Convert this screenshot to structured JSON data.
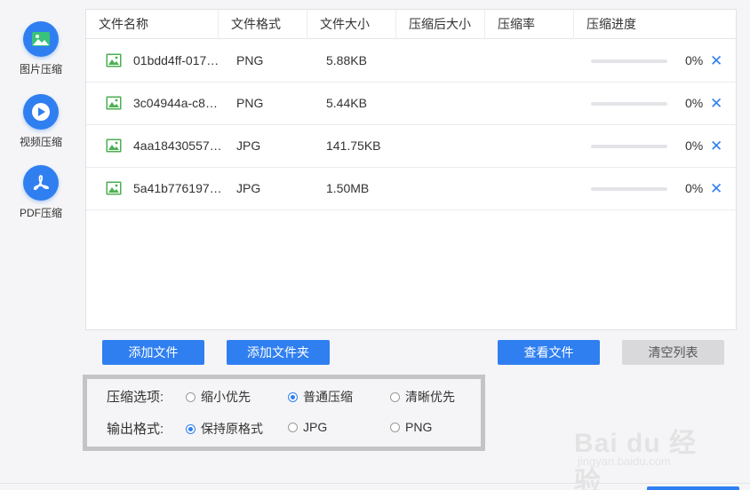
{
  "sidebar": {
    "items": [
      {
        "label": "图片压缩",
        "icon": "image-icon"
      },
      {
        "label": "视频压缩",
        "icon": "play-icon"
      },
      {
        "label": "PDF压缩",
        "icon": "pdf-icon"
      }
    ]
  },
  "table": {
    "headers": [
      "文件名称",
      "文件格式",
      "文件大小",
      "压缩后大小",
      "压缩率",
      "压缩进度"
    ],
    "rows": [
      {
        "name": "01bdd4ff-017…",
        "format": "PNG",
        "size": "5.88KB",
        "compressed_size": "",
        "ratio": "",
        "progress": 0,
        "progress_text": "0%",
        "remove": "✕"
      },
      {
        "name": "3c04944a-c8…",
        "format": "PNG",
        "size": "5.44KB",
        "compressed_size": "",
        "ratio": "",
        "progress": 0,
        "progress_text": "0%",
        "remove": "✕"
      },
      {
        "name": "4aa18430557…",
        "format": "JPG",
        "size": "141.75KB",
        "compressed_size": "",
        "ratio": "",
        "progress": 0,
        "progress_text": "0%",
        "remove": "✕"
      },
      {
        "name": "5a41b776197…",
        "format": "JPG",
        "size": "1.50MB",
        "compressed_size": "",
        "ratio": "",
        "progress": 0,
        "progress_text": "0%",
        "remove": "✕"
      }
    ]
  },
  "buttons": {
    "add_file": "添加文件",
    "add_folder": "添加文件夹",
    "view_files": "查看文件",
    "clear_list": "清空列表"
  },
  "options": {
    "compress_label": "压缩选项:",
    "compress_choices": [
      {
        "label": "缩小优先",
        "selected": false
      },
      {
        "label": "普通压缩",
        "selected": true
      },
      {
        "label": "清晰优先",
        "selected": false
      }
    ],
    "format_label": "输出格式:",
    "format_choices": [
      {
        "label": "保持原格式",
        "selected": true
      },
      {
        "label": "JPG",
        "selected": false
      },
      {
        "label": "PNG",
        "selected": false
      }
    ]
  },
  "watermark": {
    "text": "Bai du 经验",
    "sub": "jingyan.baidu.com"
  },
  "colors": {
    "accent": "#2f7ff0",
    "file_icon": "#4caf50",
    "clear_button": "#d9d9dc"
  }
}
